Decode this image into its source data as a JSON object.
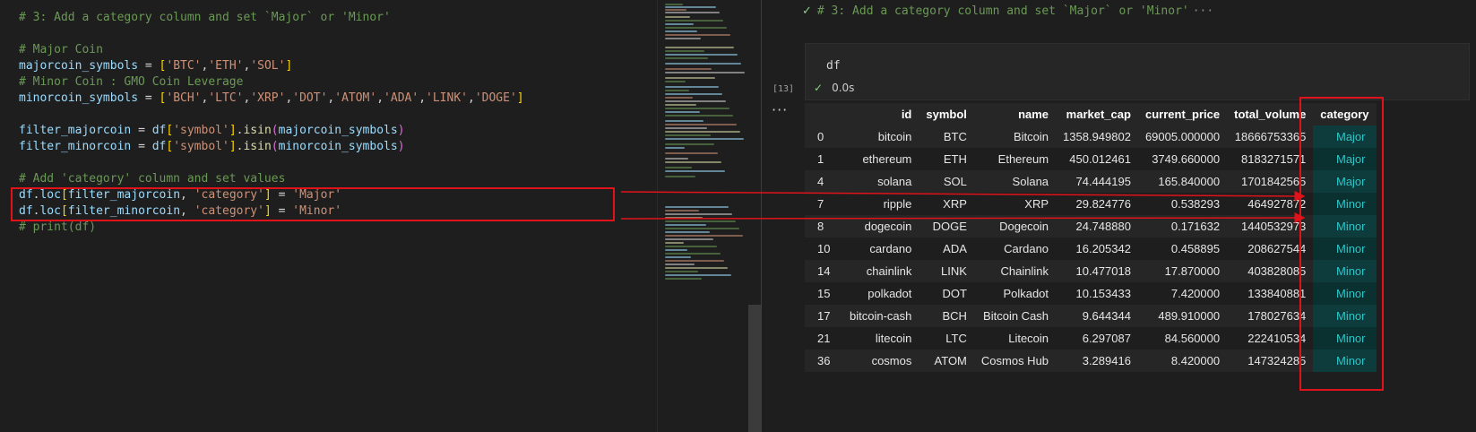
{
  "editor": {
    "lines": [
      {
        "text": "# 3: Add a category column and set `Major` or 'Minor'"
      },
      {
        "text": ""
      },
      {
        "text": "# Major Coin"
      },
      {
        "text": "majorcoin_symbols = ['BTC','ETH','SOL']"
      },
      {
        "text": "# Minor Coin : GMO Coin Leverage"
      },
      {
        "text": "minorcoin_symbols = ['BCH','LTC','XRP','DOT','ATOM','ADA','LINK','DOGE']"
      },
      {
        "text": ""
      },
      {
        "text": "filter_majorcoin = df['symbol'].isin(majorcoin_symbols)"
      },
      {
        "text": "filter_minorcoin = df['symbol'].isin(minorcoin_symbols)"
      },
      {
        "text": ""
      },
      {
        "text": "# Add 'category' column and set values"
      },
      {
        "text": "df.loc[filter_majorcoin, 'category'] = 'Major'"
      },
      {
        "text": "df.loc[filter_minorcoin, 'category'] = 'Minor'"
      },
      {
        "text": "# print(df)"
      }
    ]
  },
  "notebook": {
    "cell_header": "# 3: Add a category column and set `Major` or 'Minor'",
    "cell_header_more": "···",
    "cell_code": "df",
    "exec_count": "[13]",
    "exec_time": "0.0s",
    "output_more": "···",
    "table": {
      "columns": [
        "id",
        "symbol",
        "name",
        "market_cap",
        "current_price",
        "total_volume",
        "category"
      ],
      "rows": [
        {
          "index": "0",
          "cells": [
            "bitcoin",
            "BTC",
            "Bitcoin",
            "1358.949802",
            "69005.000000",
            "18666753365",
            "Major"
          ]
        },
        {
          "index": "1",
          "cells": [
            "ethereum",
            "ETH",
            "Ethereum",
            "450.012461",
            "3749.660000",
            "8183271571",
            "Major"
          ]
        },
        {
          "index": "4",
          "cells": [
            "solana",
            "SOL",
            "Solana",
            "74.444195",
            "165.840000",
            "1701842565",
            "Major"
          ]
        },
        {
          "index": "7",
          "cells": [
            "ripple",
            "XRP",
            "XRP",
            "29.824776",
            "0.538293",
            "464927872",
            "Minor"
          ]
        },
        {
          "index": "8",
          "cells": [
            "dogecoin",
            "DOGE",
            "Dogecoin",
            "24.748880",
            "0.171632",
            "1440532973",
            "Minor"
          ]
        },
        {
          "index": "10",
          "cells": [
            "cardano",
            "ADA",
            "Cardano",
            "16.205342",
            "0.458895",
            "208627544",
            "Minor"
          ]
        },
        {
          "index": "14",
          "cells": [
            "chainlink",
            "LINK",
            "Chainlink",
            "10.477018",
            "17.870000",
            "403828085",
            "Minor"
          ]
        },
        {
          "index": "15",
          "cells": [
            "polkadot",
            "DOT",
            "Polkadot",
            "10.153433",
            "7.420000",
            "133840881",
            "Minor"
          ]
        },
        {
          "index": "17",
          "cells": [
            "bitcoin-cash",
            "BCH",
            "Bitcoin Cash",
            "9.644344",
            "489.910000",
            "178027634",
            "Minor"
          ]
        },
        {
          "index": "21",
          "cells": [
            "litecoin",
            "LTC",
            "Litecoin",
            "6.297087",
            "84.560000",
            "222410534",
            "Minor"
          ]
        },
        {
          "index": "36",
          "cells": [
            "cosmos",
            "ATOM",
            "Cosmos Hub",
            "3.289416",
            "8.420000",
            "147324285",
            "Minor"
          ]
        }
      ]
    }
  },
  "colors": {
    "annotation": "#e0131a",
    "comment": "#6a9955",
    "category_text": "#2bc7c9",
    "success": "#89d185"
  },
  "icons": {
    "check": "check-icon",
    "more": "ellipsis-icon"
  }
}
